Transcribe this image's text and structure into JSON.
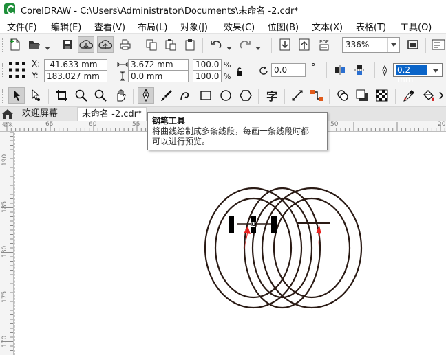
{
  "app": {
    "title": "CorelDRAW - C:\\Users\\Administrator\\Documents\\未命名 -2.cdr*",
    "brand_color": "#1f8f3a"
  },
  "menu": {
    "items": [
      {
        "label": "文件(F)"
      },
      {
        "label": "编辑(E)"
      },
      {
        "label": "查看(V)"
      },
      {
        "label": "布局(L)"
      },
      {
        "label": "对象(J)"
      },
      {
        "label": "效果(C)"
      },
      {
        "label": "位图(B)"
      },
      {
        "label": "文本(X)"
      },
      {
        "label": "表格(T)"
      },
      {
        "label": "工具(O)"
      }
    ]
  },
  "standard_toolbar": {
    "zoom_level": "336%",
    "icons": [
      "new-document-icon",
      "open-icon",
      "save-icon",
      "cloud-download-icon",
      "cloud-upload-icon",
      "print-icon",
      "copy-icon",
      "paste-icon",
      "undo-icon",
      "redo-icon",
      "import-icon",
      "export-icon",
      "pdf-icon",
      "full-screen-icon",
      "options-icon"
    ]
  },
  "property_bar": {
    "x_label": "X:",
    "x_value": "-41.633 mm",
    "y_label": "Y:",
    "y_value": "183.027 mm",
    "width_value": "3.672 mm",
    "height_value": "0.0 mm",
    "scale_x": "100.0",
    "scale_y": "100.0",
    "percent": "%",
    "rotation": "0.0",
    "degree_symbol": "°",
    "outline_width": "0.2 mm",
    "selection_color": "#0a64c8"
  },
  "toolbox": {
    "active_tool": "pen-tool",
    "icons": [
      "pick-tool-icon",
      "shape-tool-icon",
      "crop-tool-icon",
      "zoom-tool-icon",
      "zoom-out-icon",
      "pan-tool-icon",
      "pen-tool-icon",
      "artistic-media-icon",
      "spiral-tool-icon",
      "rectangle-tool-icon",
      "ellipse-tool-icon",
      "polygon-tool-icon",
      "text-tool-icon",
      "connector-tool-icon",
      "dimension-tool-icon",
      "contour-tool-icon",
      "shadow-tool-icon",
      "transparency-tool-icon",
      "eyedropper-tool-icon",
      "fill-tool-icon"
    ],
    "text_tool_glyph": "字"
  },
  "tabs": {
    "items": [
      {
        "label": "欢迎屏幕"
      },
      {
        "label": "未命名 -2.cdr*"
      }
    ]
  },
  "rulers": {
    "horizontal_labels": [
      "65",
      "60",
      "55",
      "50",
      "20"
    ],
    "vertical_labels": [
      "190",
      "185",
      "180",
      "175",
      "170"
    ],
    "unit_marker": "毫米"
  },
  "tooltip": {
    "title": "钢笔工具",
    "description_line1": "将曲线绘制成多条线段，每画一条线段时都",
    "description_line2": "可以进行预览。"
  },
  "canvas": {
    "stroke_color": "#2a1a14",
    "arrow_color": "#e8201e",
    "handle_color": "#000000"
  }
}
